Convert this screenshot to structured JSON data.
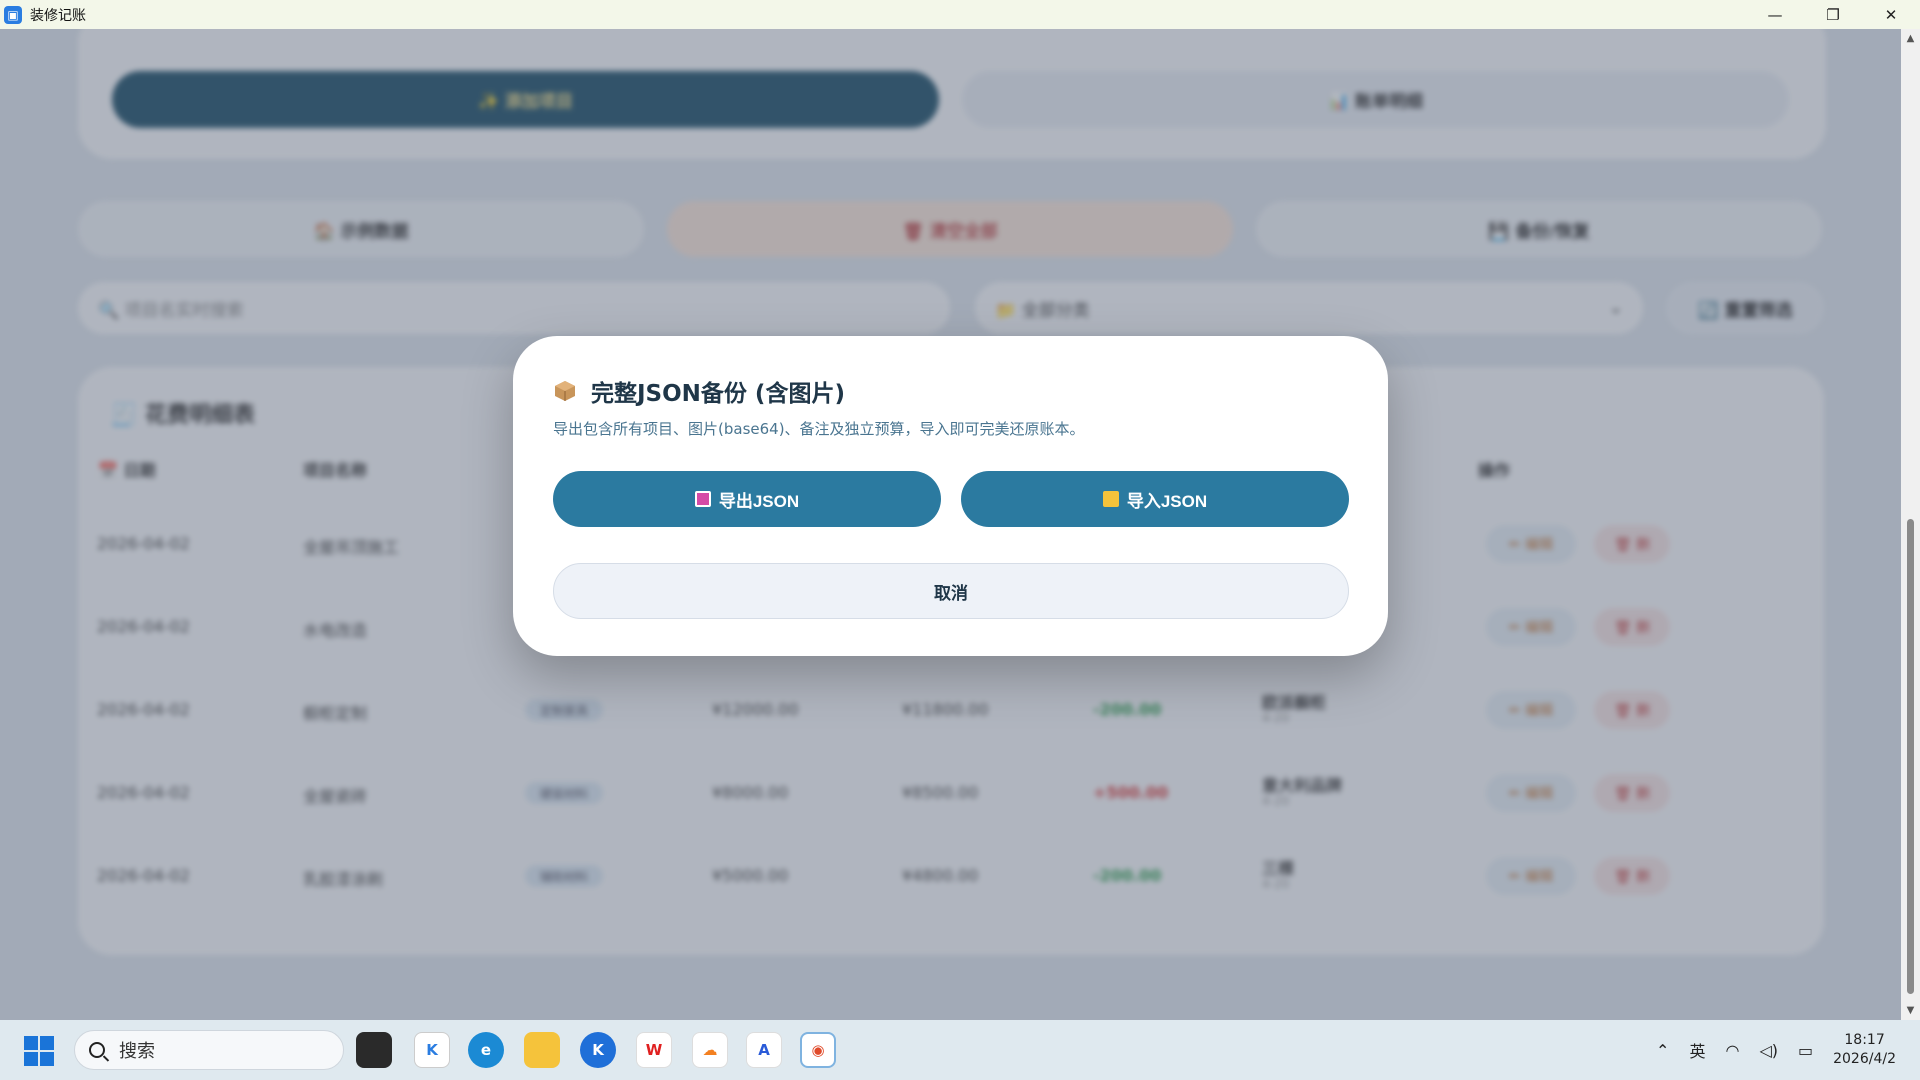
{
  "window": {
    "title": "装修记账"
  },
  "background": {
    "tabs": [
      "✨ 添加项目",
      "📊 账单明细"
    ],
    "actions": [
      "🏠 示例数据",
      "🗑 清空全部",
      "💾 备份/恢复"
    ],
    "search_placeholder": "🔍 项目名实时搜索",
    "category_filter": "📁 全部分类",
    "reset_filter": "🔄 重置筛选",
    "table_title": "🧾 花费明细表",
    "headers": [
      "📅 日期",
      "项目名称",
      "操作"
    ],
    "rows": [
      {
        "date": "2026-04-02",
        "name": "全屋吊顶施工",
        "chip": "",
        "budget": "",
        "actual": "",
        "diff": "",
        "vendor": "",
        "vendor_sub": ""
      },
      {
        "date": "2026-04-02",
        "name": "水电改造",
        "chip": "",
        "budget": "",
        "actual": "",
        "diff": "",
        "vendor": "",
        "vendor_sub": ""
      },
      {
        "date": "2026-04-02",
        "name": "橱柜定制",
        "chip": "定制家具",
        "budget": "¥12000.00",
        "actual": "¥11800.00",
        "diff": "-200.00",
        "vendor": "欧派橱柜",
        "vendor_sub": "4-20"
      },
      {
        "date": "2026-04-02",
        "name": "全屋瓷砖",
        "chip": "硬装材料",
        "budget": "¥8000.00",
        "actual": "¥8500.00",
        "diff": "+500.00",
        "vendor": "意大利品牌",
        "vendor_sub": "4-20"
      },
      {
        "date": "2026-04-02",
        "name": "乳胶漆涂刷",
        "chip": "辅助材料",
        "budget": "¥5000.00",
        "actual": "¥4800.00",
        "diff": "-200.00",
        "vendor": "三棵",
        "vendor_sub": "4-20"
      }
    ],
    "edit_label": "✏ 编辑",
    "delete_label": "🗑 删"
  },
  "modal": {
    "title": "完整JSON备份 (含图片)",
    "description": "导出包含所有项目、图片(base64)、备注及独立预算，导入即可完美还原账本。",
    "export_label": "导出JSON",
    "import_label": "导入JSON",
    "cancel_label": "取消"
  },
  "taskbar": {
    "search_label": "搜索",
    "ime": "英",
    "time": "18:17",
    "date": "2026/4/2"
  },
  "colors": {
    "primary": "#2b7aa0",
    "dark_tab": "#1d4f68",
    "negative": "#2e9e4f",
    "positive": "#d63a3a"
  }
}
